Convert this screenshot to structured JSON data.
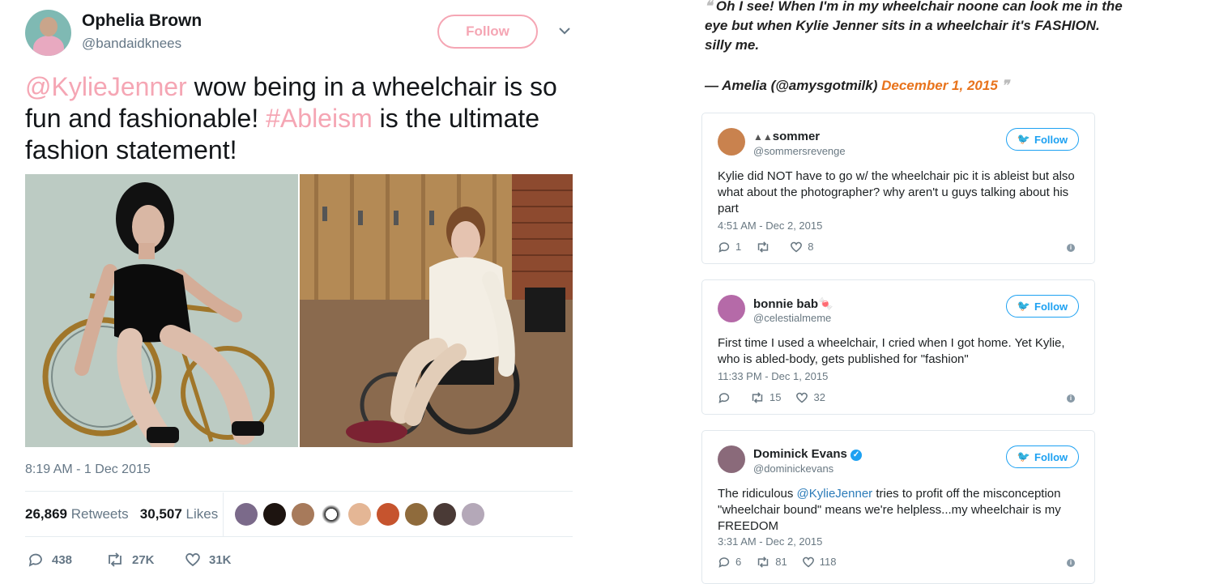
{
  "left_tweet": {
    "author_name": "Ophelia Brown",
    "author_handle": "@bandaidknees",
    "follow_label": "Follow",
    "text_mention": "@KylieJenner",
    "text_part1": " wow being in a wheelchair is so fun and fashionable! ",
    "text_hashtag": "#Ableism",
    "text_part2": " is the ultimate fashion statement!",
    "timestamp": "8:19 AM - 1 Dec 2015",
    "retweets_count": "26,869",
    "retweets_label": "Retweets",
    "likes_count": "30,507",
    "likes_label": "Likes",
    "replies": "438",
    "retweets_short": "27K",
    "likes_short": "31K"
  },
  "quote": {
    "text": "Oh I see! When I'm in my wheelchair noone can look me in the eye but when Kylie Jenner sits in a wheelchair it's FASHION. silly me.",
    "attribution": "— Amelia (@amysgotmilk)",
    "date": "December 1, 2015"
  },
  "embedded_tweets": [
    {
      "name": "sommer",
      "handle": "@sommersrevenge",
      "follow_label": "Follow",
      "body": "Kylie did NOT have to go w/ the wheelchair pic it is ableist but also what about the photographer? why aren't u guys talking about his part",
      "time": "4:51 AM - Dec 2, 2015",
      "replies": "1",
      "retweets": "",
      "likes": "8"
    },
    {
      "name": "bonnie bab",
      "handle": "@celestialmeme",
      "follow_label": "Follow",
      "body": "First time I used a wheelchair, I cried when I got home. Yet Kylie, who is abled-body, gets published for \"fashion\"",
      "time": "11:33 PM - Dec 1, 2015",
      "replies": "",
      "retweets": "15",
      "likes": "32"
    },
    {
      "name": "Dominick Evans",
      "handle": "@dominickevans",
      "follow_label": "Follow",
      "body_part1": "The ridiculous ",
      "body_mention": "@KylieJenner",
      "body_part2": " tries to profit off the misconception \"wheelchair bound\" means we're helpless...my wheelchair is my FREEDOM",
      "time": "3:31 AM - Dec 2, 2015",
      "replies": "6",
      "retweets": "81",
      "likes": "118"
    }
  ],
  "colors": {
    "pink_accent": "#f5a6b4",
    "twitter_blue": "#1da1f2",
    "date_orange": "#e8731c",
    "muted_gray": "#657786"
  }
}
